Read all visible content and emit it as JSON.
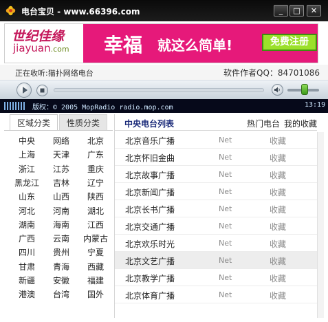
{
  "window": {
    "title": "电台宝贝 - www.66396.com",
    "minimize_glyph": "_",
    "maximize_glyph": "□",
    "close_glyph": "✕"
  },
  "banner": {
    "logo_cn": "世纪佳缘",
    "logo_en_prefix": "jiayuan",
    "logo_en_suffix": ".com",
    "ad_main": "幸福",
    "ad_sub": "就这么简单!",
    "register_label": "免费注册",
    "colors": {
      "ad_background": "#e6197a",
      "register_button": "#9be02a"
    }
  },
  "info": {
    "now_playing": "正在收听:猫扑网络电台",
    "author_qq": "软件作者QQ：84701086"
  },
  "player": {
    "volume_level": 0.55,
    "play_icon": "play-icon",
    "stop_icon": "stop-icon",
    "volume_icon": "speaker-icon"
  },
  "ticker": {
    "text": "版权：© 2005 MopRadio radio.mop.com",
    "time": "13:19"
  },
  "left_panel": {
    "tabs": [
      "区域分类",
      "性质分类"
    ],
    "active_tab": 0,
    "regions": [
      "中央",
      "网络",
      "北京",
      "上海",
      "天津",
      "广东",
      "浙江",
      "江苏",
      "重庆",
      "黑龙江",
      "吉林",
      "辽宁",
      "山东",
      "山西",
      "陕西",
      "河北",
      "河南",
      "湖北",
      "湖南",
      "海南",
      "江西",
      "广西",
      "云南",
      "内蒙古",
      "四川",
      "贵州",
      "宁夏",
      "甘肃",
      "青海",
      "西藏",
      "新疆",
      "安徽",
      "福建",
      "港澳",
      "台湾",
      "国外"
    ]
  },
  "station_list": {
    "title": "中央电台列表",
    "hot_label": "热门电台",
    "favorites_label": "我的收藏",
    "stations": [
      {
        "name": "北京音乐广播",
        "type": "Net",
        "action": "收藏"
      },
      {
        "name": "北京怀旧金曲",
        "type": "Net",
        "action": "收藏"
      },
      {
        "name": "北京故事广播",
        "type": "Net",
        "action": "收藏"
      },
      {
        "name": "北京新闻广播",
        "type": "Net",
        "action": "收藏"
      },
      {
        "name": "北京长书广播",
        "type": "Net",
        "action": "收藏"
      },
      {
        "name": "北京交通广播",
        "type": "Net",
        "action": "收藏"
      },
      {
        "name": "北京欢乐时光",
        "type": "Net",
        "action": "收藏"
      },
      {
        "name": "北京文艺广播",
        "type": "Net",
        "action": "收藏"
      },
      {
        "name": "北京教学广播",
        "type": "Net",
        "action": "收藏"
      },
      {
        "name": "北京体育广播",
        "type": "Net",
        "action": "收藏"
      }
    ],
    "selected_index": 7
  }
}
